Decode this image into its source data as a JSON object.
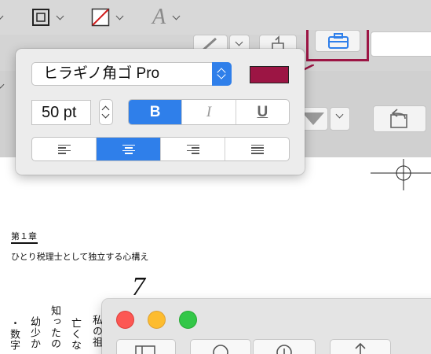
{
  "toolbar": {
    "items": [
      {
        "icon": "chevron-down-icon"
      },
      {
        "icon": "border-style-icon"
      },
      {
        "icon": "fill-none-icon"
      },
      {
        "icon": "text-style-icon",
        "glyph": "A"
      }
    ]
  },
  "text_popover": {
    "font_name": "ヒラギノ角ゴ Pro",
    "text_color": "#9c1544",
    "font_size": "50 pt",
    "bold_label": "B",
    "italic_label": "I",
    "underline_label": "U",
    "bold_active": true,
    "alignment_options": [
      "left",
      "center",
      "right",
      "justify"
    ],
    "alignment_selected": "center"
  },
  "document": {
    "chapter_label": "第１章",
    "subtitle": "ひとり税理士として独立する心構え",
    "page_number": "7",
    "vertical_text": [
      "私の祖",
      "亡くな",
      "知ったの",
      "幼少か",
      "・数字"
    ]
  },
  "floating_window": {
    "traffic_lights": {
      "close": "#fc5753",
      "minimize": "#fdbc2e",
      "zoom": "#33c748"
    }
  },
  "colors": {
    "accent": "#2f7fea",
    "frame_accent": "#9c1544"
  }
}
